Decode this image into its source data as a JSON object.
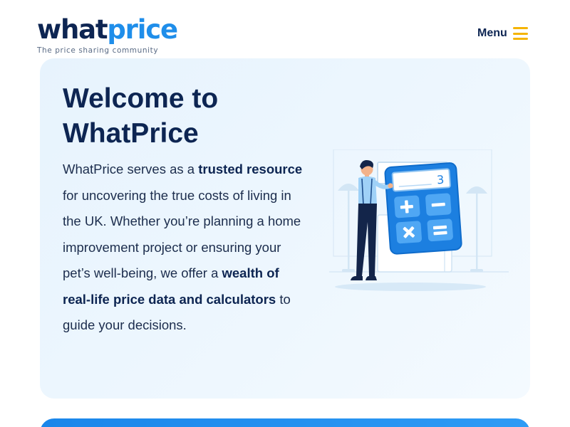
{
  "header": {
    "logo": {
      "part1": "what",
      "part2": "price",
      "tagline": "The price sharing community"
    },
    "menu_label": "Menu"
  },
  "hero": {
    "title_line1": "Welcome to",
    "title_line2": "WhatPrice",
    "text": {
      "t1": "WhatPrice serves as a ",
      "b1": "trusted resource",
      "t2": " for uncovering the true costs of living in the UK. Whether you’re planning a home improvement project or ensuring your pet’s well-being, we offer a ",
      "b2": "wealth of real-life price data and calculators",
      "t3": " to guide your decisions."
    },
    "illustration_icon": "person-with-calculator-illustration",
    "calculator_display": "3"
  },
  "colors": {
    "brand_dark": "#0d2552",
    "brand_blue": "#1f8eea",
    "menu_accent": "#f5b400",
    "hero_bg": "#eaf5fe"
  }
}
